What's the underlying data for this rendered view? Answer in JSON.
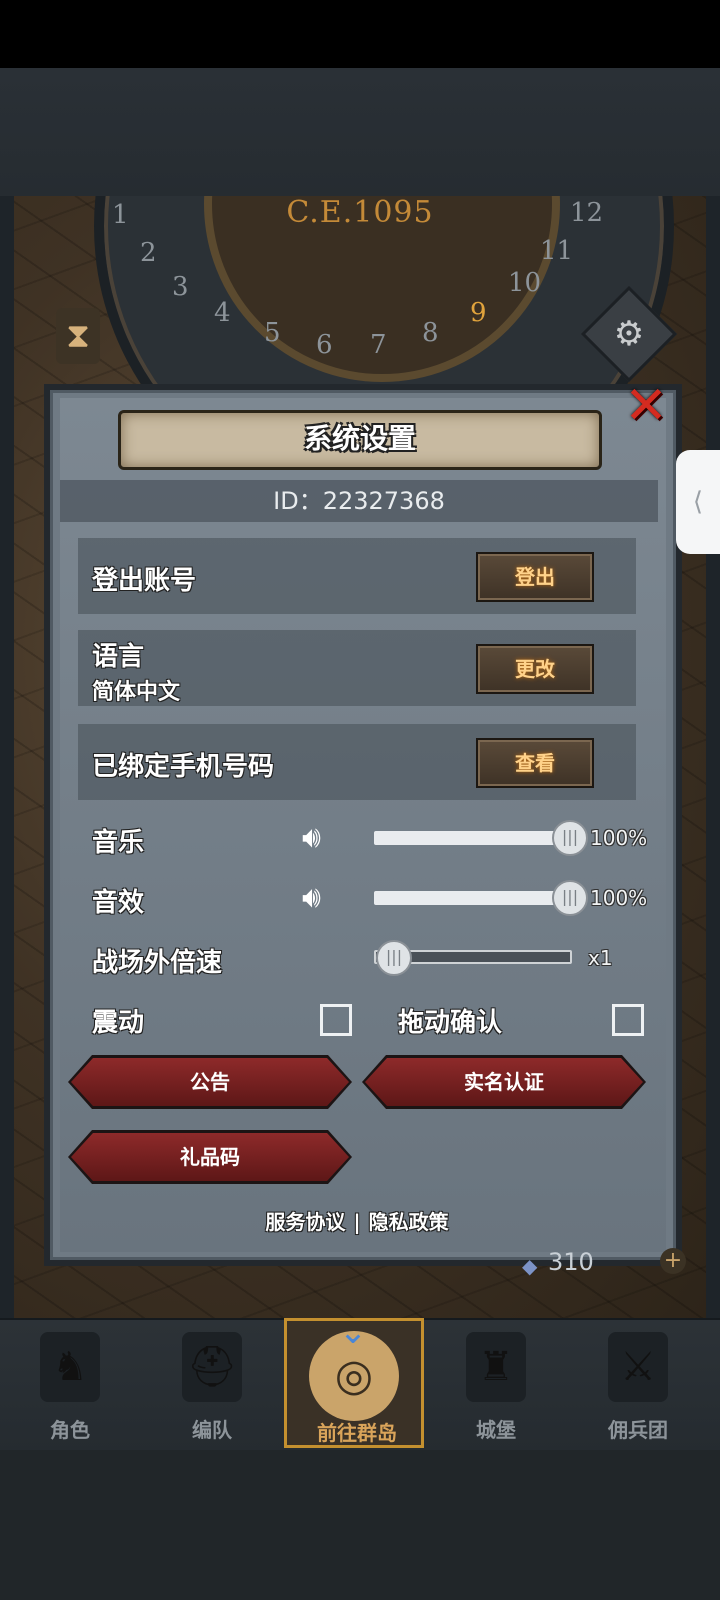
{
  "map": {
    "year": "C.E.1095",
    "dial_numbers": [
      "1",
      "2",
      "3",
      "4",
      "5",
      "6",
      "7",
      "8",
      "9",
      "10",
      "11",
      "12"
    ],
    "active_number": "9",
    "resource_value": "310"
  },
  "settings": {
    "title": "系统设置",
    "id_text": "ID：22327368",
    "logout": {
      "label": "登出账号",
      "button": "登出"
    },
    "language": {
      "label": "语言",
      "value": "简体中文",
      "button": "更改"
    },
    "phone": {
      "label": "已绑定手机号码",
      "button": "查看"
    },
    "music": {
      "label": "音乐",
      "percent": "100%",
      "level": 1.0
    },
    "sfx": {
      "label": "音效",
      "percent": "100%",
      "level": 1.0
    },
    "speed": {
      "label": "战场外倍速",
      "value": "x1",
      "level": 0.0
    },
    "vibration": {
      "label": "震动",
      "checked": false
    },
    "drag_confirm": {
      "label": "拖动确认",
      "checked": false
    },
    "buttons": {
      "notice": "公告",
      "realname": "实名认证",
      "gift": "礼品码"
    },
    "links": {
      "service": "服务协议",
      "separator": "|",
      "privacy": "隐私政策"
    }
  },
  "nav": {
    "items": [
      {
        "label": "角色",
        "icon": "knight-icon"
      },
      {
        "label": "编队",
        "icon": "helmet-icon"
      },
      {
        "label": "前往群岛",
        "icon": "globe-icon",
        "active": true
      },
      {
        "label": "城堡",
        "icon": "castle-icon"
      },
      {
        "label": "佣兵团",
        "icon": "mercenary-icon"
      }
    ]
  },
  "colors": {
    "accent_gold": "#c4902f",
    "close_red": "#d42b20",
    "button_red": "#8e2a2a",
    "panel_gray": "#6f7a84"
  }
}
